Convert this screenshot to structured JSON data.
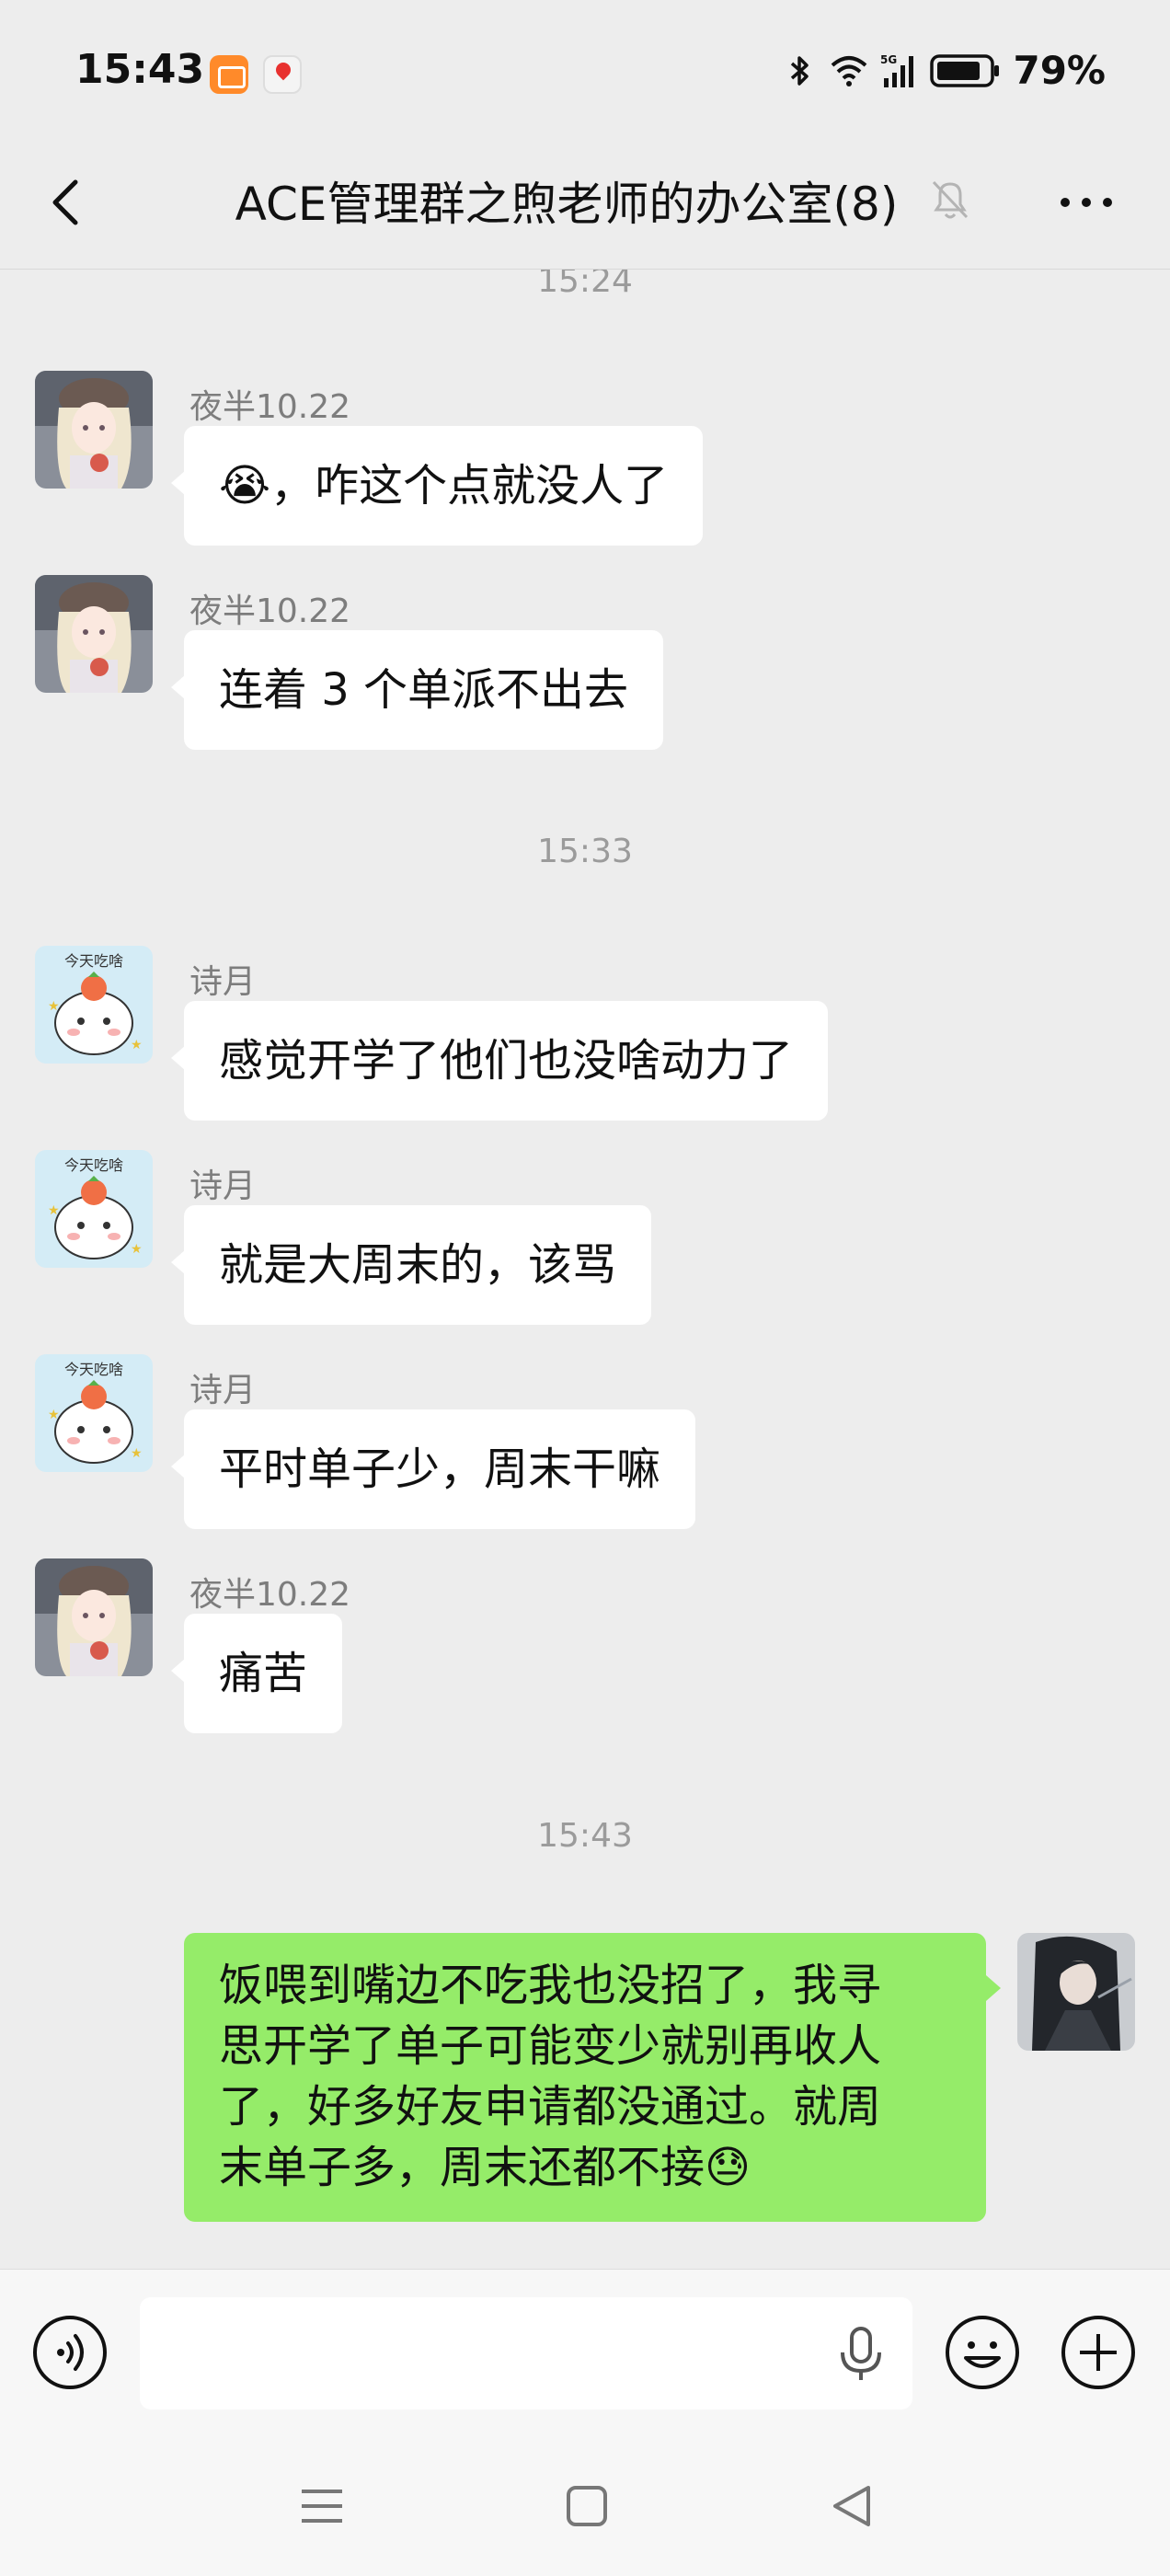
{
  "status_bar": {
    "time": "15:43",
    "battery": "79%",
    "network": "5G",
    "icons": [
      "calendar-app-icon",
      "map-app-icon",
      "bluetooth-icon",
      "wifi-icon",
      "signal-icon",
      "battery-icon"
    ]
  },
  "header": {
    "title": "ACE管理群之煦老师的办公室(8)",
    "icons": [
      "back-icon",
      "mute-bell-icon",
      "more-icon"
    ]
  },
  "chat": {
    "timestamps": [
      "15:24",
      "15:33",
      "15:43"
    ],
    "messages": [
      {
        "sender": "夜半10.22",
        "avatar": "anime-girl-avatar",
        "emoji": "😭",
        "text": "，咋这个点就没人了"
      },
      {
        "sender": "夜半10.22",
        "avatar": "anime-girl-avatar",
        "text": "连着 3 个单派不出去"
      },
      {
        "sender": "诗月",
        "avatar": "cat-avatar",
        "text": "感觉开学了他们也没啥动力了"
      },
      {
        "sender": "诗月",
        "avatar": "cat-avatar",
        "text": "就是大周末的，该骂"
      },
      {
        "sender": "诗月",
        "avatar": "cat-avatar",
        "text": "平时单子少，周末干嘛"
      },
      {
        "sender": "夜半10.22",
        "avatar": "anime-girl-avatar",
        "text": "痛苦"
      }
    ],
    "own_message": {
      "avatar": "swordsman-avatar",
      "lines": [
        "饭喂到嘴边不吃我也没招了，我寻",
        "思开学了单子可能变少就别再收人",
        "了，好多好友申请都没通过。就周",
        "末单子多，周末还都不接"
      ],
      "emoji": "😓"
    },
    "avatar_labels": {
      "cat": "今天吃啥"
    }
  },
  "input_bar": {
    "placeholder": "",
    "icons": [
      "voice-icon",
      "mic-icon",
      "emoji-icon",
      "plus-icon"
    ]
  },
  "nav_bar": {
    "icons": [
      "menu-icon",
      "home-icon",
      "back-triangle-icon"
    ]
  },
  "colors": {
    "background": "#ededed",
    "own_bubble": "#95ec69",
    "other_bubble": "#ffffff",
    "timestamp": "#9b9b9b"
  }
}
